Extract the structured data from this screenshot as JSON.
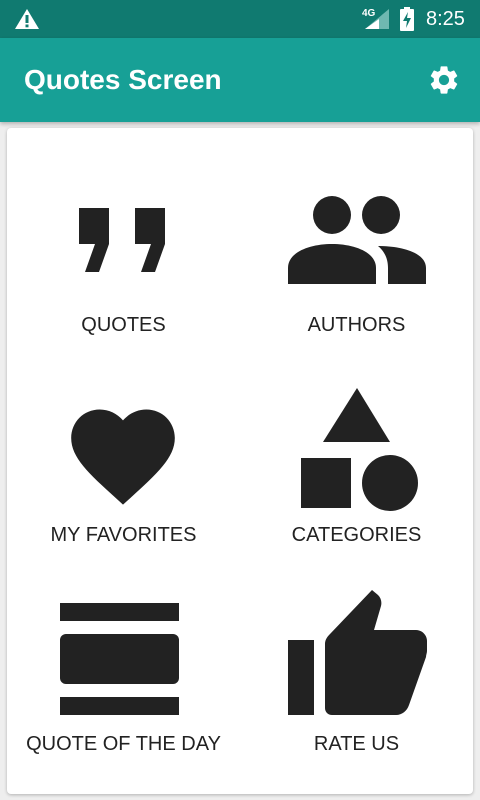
{
  "status_bar": {
    "network": "4G",
    "time": "8:25"
  },
  "app_bar": {
    "title": "Quotes Screen",
    "settings_icon": "gear-icon"
  },
  "colors": {
    "status_bar": "#107a70",
    "app_bar": "#17a096",
    "icon": "#222222"
  },
  "menu": {
    "items": [
      {
        "label": "QUOTES",
        "icon": "quote-icon"
      },
      {
        "label": "AUTHORS",
        "icon": "people-icon"
      },
      {
        "label": "MY FAVORITES",
        "icon": "heart-icon"
      },
      {
        "label": "CATEGORIES",
        "icon": "shapes-icon"
      },
      {
        "label": "QUOTE OF THE DAY",
        "icon": "view-day-icon"
      },
      {
        "label": "RATE US",
        "icon": "thumb-up-icon"
      }
    ]
  }
}
